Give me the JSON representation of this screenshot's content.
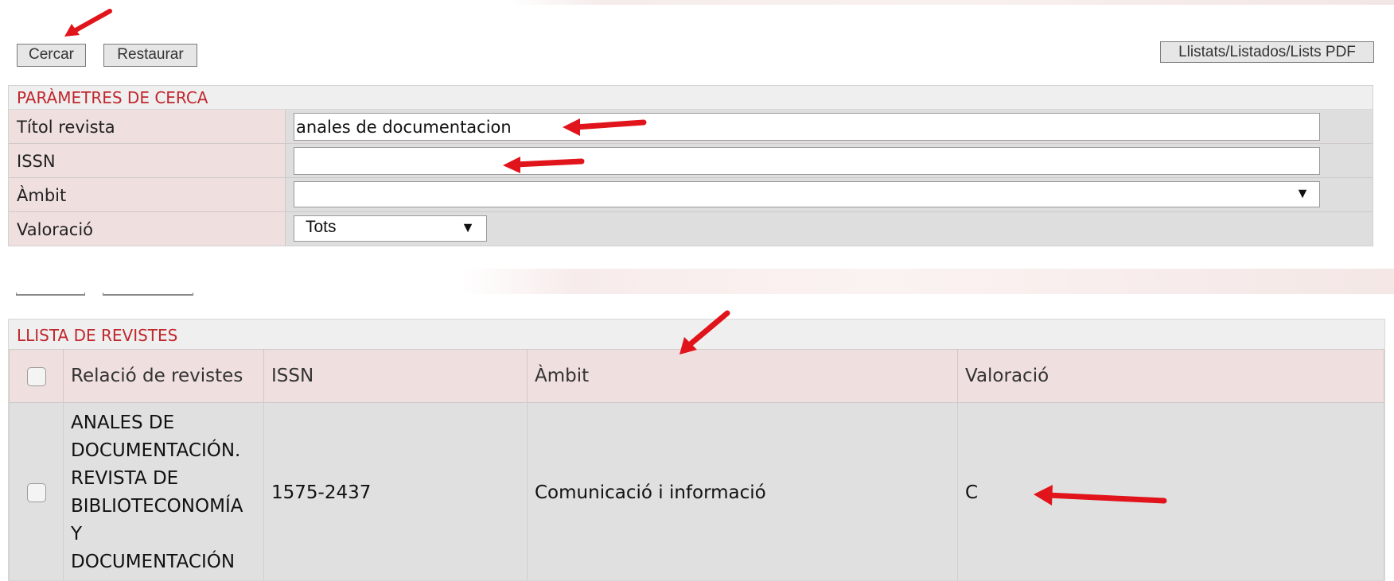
{
  "toolbar": {
    "search_label": "Cercar",
    "reset_label": "Restaurar",
    "pdf_label": "Llistats/Listados/Lists PDF"
  },
  "params": {
    "title": "PARÀMETRES DE CERCA",
    "rows": [
      {
        "label": "Títol revista",
        "value": "anales de documentacion"
      },
      {
        "label": "ISSN",
        "value": ""
      },
      {
        "label": "Àmbit",
        "value": ""
      },
      {
        "label": "Valoració",
        "value": "Tots"
      }
    ]
  },
  "results": {
    "title": "LLISTA DE REVISTES",
    "columns": [
      "Relació de revistes",
      "ISSN",
      "Àmbit",
      "Valoració"
    ],
    "rows": [
      {
        "name_lines": [
          "ANALES DE",
          "DOCUMENTACIÓN.",
          "REVISTA DE",
          "BIBLIOTECONOMÍA",
          "Y",
          "DOCUMENTACIÓN"
        ],
        "issn": "1575-2437",
        "ambit": "Comunicació i informació",
        "valoracio": "C"
      }
    ]
  },
  "colors": {
    "accent_red": "#c0272d",
    "label_bg": "#f0dfdf",
    "field_bg": "#dedede",
    "annotation_arrow": "#e0141a"
  },
  "icons": [
    "checkbox",
    "dropdown-arrow-icon",
    "annotation-arrow-icon"
  ]
}
